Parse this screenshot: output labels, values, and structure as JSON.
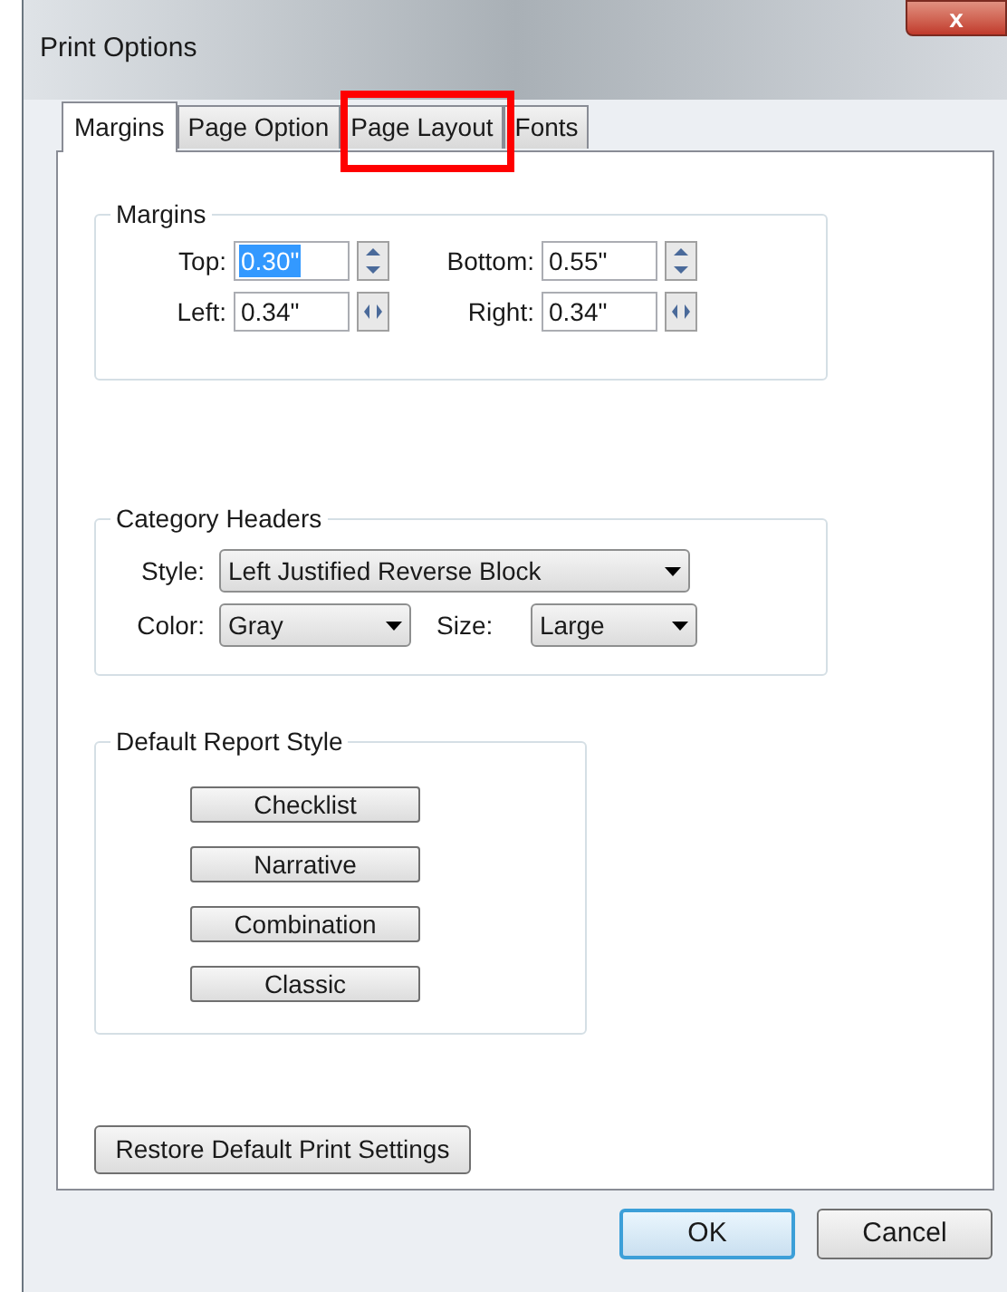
{
  "window": {
    "title": "Print Options",
    "close": "x"
  },
  "tabs": [
    {
      "label": "Margins",
      "selected": true,
      "highlighted": false
    },
    {
      "label": "Page Option",
      "selected": false,
      "highlighted": false
    },
    {
      "label": "Page Layout",
      "selected": false,
      "highlighted": true
    },
    {
      "label": "Fonts",
      "selected": false,
      "highlighted": false
    }
  ],
  "margins": {
    "title": "Margins",
    "fields": [
      {
        "label": "Top:",
        "value": "0.30\"",
        "selected": true,
        "kind": "vertical"
      },
      {
        "label": "Bottom:",
        "value": "0.55\"",
        "selected": false,
        "kind": "vertical"
      },
      {
        "label": "Left:",
        "value": "0.34\"",
        "selected": false,
        "kind": "horizontal"
      },
      {
        "label": "Right:",
        "value": "0.34\"",
        "selected": false,
        "kind": "horizontal"
      }
    ]
  },
  "category_headers": {
    "title": "Category Headers",
    "style": {
      "label": "Style:",
      "value": "Left Justified Reverse Block"
    },
    "color": {
      "label": "Color:",
      "value": "Gray"
    },
    "size": {
      "label": "Size:",
      "value": "Large"
    }
  },
  "default_report_style": {
    "title": "Default Report Style",
    "buttons": [
      "Checklist",
      "Narrative",
      "Combination",
      "Classic"
    ]
  },
  "restore_button": "Restore Default Print Settings",
  "buttons": [
    {
      "label": "OK",
      "default": true
    },
    {
      "label": "Cancel",
      "default": false
    }
  ]
}
